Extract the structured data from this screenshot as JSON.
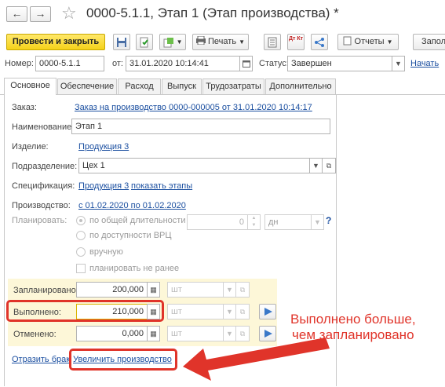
{
  "window": {
    "back_glyph": "←",
    "forward_glyph": "→",
    "star_glyph": "☆",
    "title": "0000-5.1.1, Этап 1 (Этап производства) *"
  },
  "toolbar": {
    "post_close": "Провести и закрыть",
    "print": "Печать",
    "dtkt": "Дт Кт",
    "reports": "Отчеты",
    "fill": "Запол"
  },
  "header": {
    "number_label": "Номер:",
    "number_value": "0000-5.1.1",
    "from_label": "от:",
    "date_value": "31.01.2020 10:14:41",
    "status_label": "Статус:",
    "status_value": "Завершен",
    "start_link": "Начать"
  },
  "tabs": [
    "Основное",
    "Обеспечение",
    "Расход",
    "Выпуск",
    "Трудозатраты",
    "Дополнительно"
  ],
  "form": {
    "order_label": "Заказ:",
    "order_link": "Заказ на производство 0000-000005 от 31.01.2020 10:14:17",
    "name_label": "Наименование:",
    "name_value": "Этап 1",
    "product_label": "Изделие:",
    "product_link": "Продукция 3",
    "division_label": "Подразделение:",
    "division_value": "Цех 1",
    "spec_label": "Спецификация:",
    "spec_link": "Продукция 3",
    "show_stages_link": "показать этапы",
    "production_label": "Производство:",
    "production_link": "с 01.02.2020 по 01.02.2020",
    "plan_label": "Планировать:",
    "opt_total_duration": "по общей длительности",
    "duration_value": "0",
    "duration_unit": "дн",
    "help_glyph": "?",
    "opt_vrc": "по доступности ВРЦ",
    "opt_manual": "вручную",
    "plan_not_earlier": "планировать не ранее"
  },
  "quantities": {
    "planned_label": "Запланировано:",
    "planned_value": "200,000",
    "done_label": "Выполнено:",
    "done_value": "210,000",
    "cancelled_label": "Отменено:",
    "cancelled_value": "0,000",
    "unit_placeholder": "шт"
  },
  "links": {
    "defect": "Отразить брак",
    "increase": "Увеличить производство"
  },
  "annotation": {
    "line1": "Выполнено больше,",
    "line2": "чем запланировано",
    "color": "#e0342a"
  },
  "colors": {
    "highlight_bg": "#fdf7d8",
    "link": "#1b4fa0",
    "primary_button": "#f5d21a"
  }
}
